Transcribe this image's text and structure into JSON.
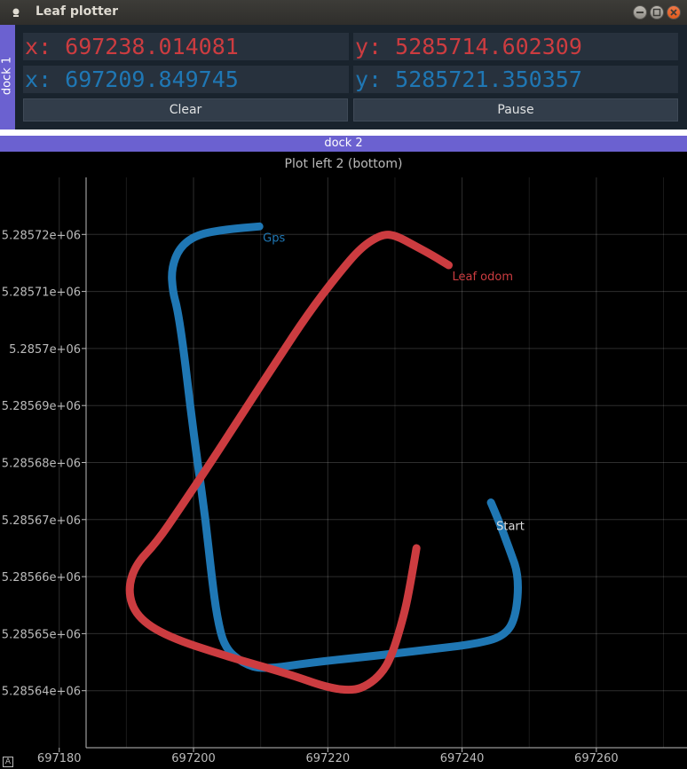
{
  "window": {
    "title": "Leaf plotter",
    "controls": [
      "minimize",
      "maximize",
      "close"
    ]
  },
  "dock1": {
    "label": "dock 1",
    "leaf_x": "x: 697238.014081",
    "leaf_y": "y: 5285714.602309",
    "gps_x": "x: 697209.849745",
    "gps_y": "y: 5285721.350357",
    "clear_label": "Clear",
    "pause_label": "Pause"
  },
  "dock2": {
    "label": "dock 2"
  },
  "colors": {
    "leaf": "#cc3c40",
    "gps": "#1f77b4",
    "dock_tab": "#6b61d0"
  },
  "chart_data": {
    "type": "line",
    "title": "Plot left 2 (bottom)",
    "xlabel": "",
    "ylabel": "",
    "xlim": [
      697184,
      697273.5
    ],
    "ylim": [
      5285630,
      5285730
    ],
    "x_ticks": [
      697180,
      697200,
      697220,
      697240,
      697260
    ],
    "y_ticks": [
      5285640,
      5285650,
      5285660,
      5285670,
      5285680,
      5285690,
      5285700,
      5285710,
      5285720
    ],
    "x_tick_labels": [
      "697180",
      "697200",
      "697220",
      "697240",
      "697260"
    ],
    "y_tick_labels": [
      "5.28564e+06",
      "5.28565e+06",
      "5.28566e+06",
      "5.28567e+06",
      "5.28568e+06",
      "5.28569e+06",
      "5.2857e+06",
      "5.28571e+06",
      "5.28572e+06"
    ],
    "grid": true,
    "series": [
      {
        "name": "Gps",
        "color": "#1f77b4",
        "x": [
          697244.3,
          697245.4,
          697247.0,
          697248.5,
          697248.0,
          697246.2,
          697242.0,
          697235.0,
          697227.0,
          697218.0,
          697210.4,
          697207.3,
          697204.6,
          697203.5,
          697202.7,
          697201.8,
          697200.6,
          697199.5,
          697198.5,
          697197.6,
          697196.9,
          697196.7,
          697197.9,
          697200.5,
          697205.0,
          697209.8
        ],
        "y": [
          5285673.0,
          5285670.0,
          5285665.0,
          5285660.0,
          5285652.7,
          5285649.5,
          5285648.2,
          5285647.2,
          5285646.1,
          5285645.0,
          5285643.7,
          5285644.8,
          5285647.6,
          5285652.9,
          5285660.0,
          5285670.0,
          5285680.0,
          5285690.0,
          5285700.0,
          5285707.0,
          5285710.0,
          5285714.0,
          5285717.7,
          5285720.0,
          5285720.9,
          5285721.4
        ]
      },
      {
        "name": "Leaf odom",
        "color": "#cc3c40",
        "x": [
          697233.2,
          697232.2,
          697231.3,
          697229.5,
          697228.0,
          697226.0,
          697223.8,
          697220.0,
          697214.0,
          697205.0,
          697196.0,
          697191.5,
          697190.2,
          697191.3,
          697194.5,
          697198.0,
          697202.0,
          697207.5,
          697212.5,
          697217.0,
          697221.5,
          697225.0,
          697228.0,
          697230.0,
          697233.0,
          697235.8,
          697238.0
        ],
        "y": [
          5285665.0,
          5285658.0,
          5285653.0,
          5285646.0,
          5285643.0,
          5285641.0,
          5285640.0,
          5285640.5,
          5285643.0,
          5285646.0,
          5285649.5,
          5285653.0,
          5285657.5,
          5285662.0,
          5285666.0,
          5285672.0,
          5285679.0,
          5285689.0,
          5285698.0,
          5285706.0,
          5285713.0,
          5285717.8,
          5285720.0,
          5285719.9,
          5285718.0,
          5285716.2,
          5285714.6
        ]
      }
    ],
    "annotations": [
      "Start"
    ]
  }
}
